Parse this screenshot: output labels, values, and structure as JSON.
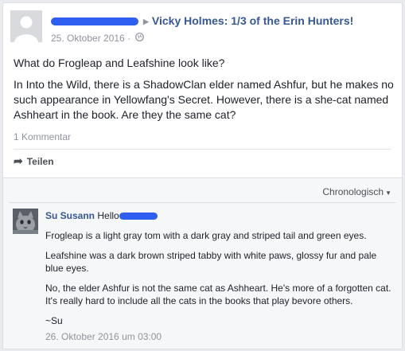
{
  "post": {
    "author_redacted": "",
    "page_name": "Vicky Holmes: 1/3 of the Erin Hunters!",
    "date": "25. Oktober 2016",
    "meta_separator": "·",
    "paragraphs": [
      "What do Frogleap and Leafshine look like?",
      "In Into the Wild, there is a ShadowClan elder named Ashfur, but he makes no such appearance in Yellowfang's Secret. However, there is a she-cat named Ashheart in the book. Are they the same cat?"
    ],
    "comment_count": "1 Kommentar",
    "share_label": "Teilen"
  },
  "comments_section": {
    "sort_label": "Chronologisch",
    "comment": {
      "author": "Su Susann",
      "greeting": "Hello",
      "paragraphs": [
        "Frogleap is a light gray tom with a dark gray and striped tail and green eyes.",
        "Leafshine was a dark brown striped tabby with white paws, glossy fur and pale blue eyes.",
        "No, the elder Ashfur is not the same cat as Ashheart. He's more of a forgotten cat. It's really hard to include all the cats in the books that play bevore others.",
        "~Su"
      ],
      "timestamp": "26. Oktober 2016 um 03:00"
    }
  },
  "icons": {
    "avatar": "default-avatar-icon",
    "arrow": "triangle-right-icon",
    "privacy": "globe-icon",
    "share": "share-arrow-icon",
    "sort_caret": "caret-down-icon",
    "commenter_avatar": "cat-photo"
  },
  "colors": {
    "link": "#365899",
    "meta": "#90949c",
    "redaction": "#2f5ff0"
  }
}
